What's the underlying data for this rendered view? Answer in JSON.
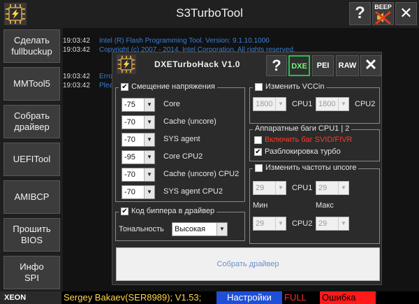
{
  "app": {
    "title": "S3TurboTool"
  },
  "titlebar": {
    "help_label": "?",
    "beep_label": "BEEP",
    "close_label": "✕"
  },
  "sidebar": {
    "items": [
      {
        "label": "Сделать\nfullbuckup"
      },
      {
        "label": "MMTool5"
      },
      {
        "label": "Собрать\nдрайвер"
      },
      {
        "label": "UEFITool"
      },
      {
        "label": "AMIBCP"
      },
      {
        "label": "Прошить\nBIOS"
      },
      {
        "label": "Инфо\nSPI"
      }
    ]
  },
  "log": {
    "lines": [
      {
        "time": "19:03:42",
        "msg": "Intel (R) Flash Programming Tool. Version:  9.1.10.1000"
      },
      {
        "time": "19:03:42",
        "msg": "Copyright (c) 2007 - 2014, Intel Corporation. All rights reserved."
      },
      {
        "time": "19:03:42",
        "msg": "Erro"
      },
      {
        "time": "19:03:42",
        "msg": "Plea"
      }
    ]
  },
  "status": {
    "brand": "XEON",
    "author": "Sergey Bakaev(SER8989); V1.53;",
    "settings": "Настройки",
    "mode": "FULL",
    "error": "Ошибка"
  },
  "dialog": {
    "title": "DXETurboHack V1.0",
    "help_label": "?",
    "tabs": [
      "DXE",
      "PEI",
      "RAW"
    ],
    "close_label": "✕",
    "voltage": {
      "title": "Смещение напряжения",
      "checked": true,
      "rows": [
        {
          "value": "-75",
          "label": "Core"
        },
        {
          "value": "-70",
          "label": "Cache (uncore)"
        },
        {
          "value": "-70",
          "label": "SYS agent"
        },
        {
          "value": "-95",
          "label": "Core CPU2"
        },
        {
          "value": "-70",
          "label": "Cache (uncore) CPU2"
        },
        {
          "value": "-70",
          "label": "SYS agent CPU2"
        }
      ]
    },
    "beeper": {
      "title": "Код биппера в драйвер",
      "checked": true,
      "tone_label": "Тональность",
      "tone_value": "Высокая"
    },
    "vccin": {
      "title": "Изменить VCCin",
      "checked": false,
      "cpu1_value": "1800",
      "cpu1_label": "CPU1",
      "cpu2_value": "1800",
      "cpu2_label": "CPU2"
    },
    "hw_bugs": {
      "title": "Аппаратные баги CPU1 | 2",
      "svid_label": "Включить баг SVID/FIVR",
      "svid_checked": false,
      "turbo_label": "Разблокировка турбо",
      "turbo_checked": true
    },
    "uncore": {
      "title": "Изменить частоты uncore",
      "checked": false,
      "cpu1_min": "29",
      "cpu1_label": "CPU1",
      "cpu1_max": "29",
      "min_label": "Мин",
      "max_label": "Макс",
      "cpu2_min": "29",
      "cpu2_label": "CPU2",
      "cpu2_max": "29"
    },
    "build_label": "Собрать драйвер"
  },
  "colors": {
    "accent_green": "#24c24a",
    "log_blue": "#3a7fd5",
    "warning_red": "#ff2a2a",
    "settings_blue": "#1f4fd6"
  }
}
